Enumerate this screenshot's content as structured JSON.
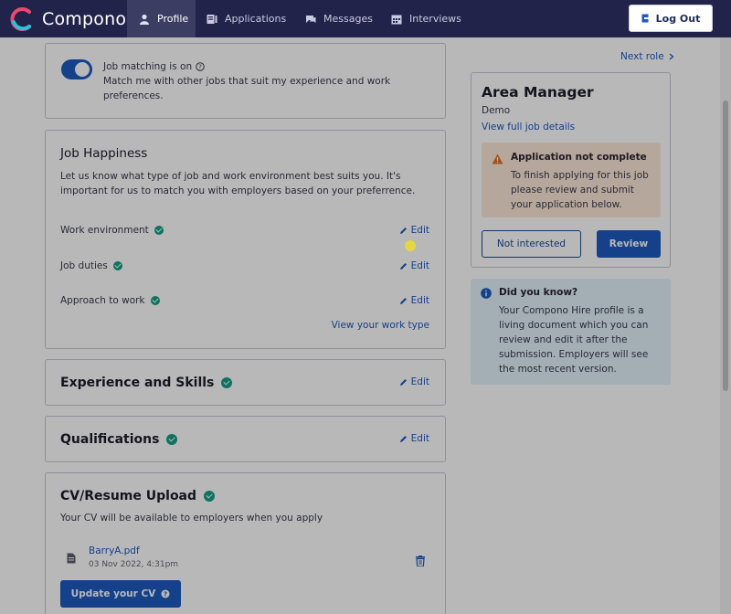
{
  "nav": {
    "brand": "Compono",
    "items": [
      {
        "label": "Profile",
        "icon": "person-icon",
        "active": true
      },
      {
        "label": "Applications",
        "icon": "applications-icon",
        "active": false
      },
      {
        "label": "Messages",
        "icon": "messages-icon",
        "active": false
      },
      {
        "label": "Interviews",
        "icon": "calendar-icon",
        "active": false
      }
    ],
    "logout_label": "Log Out"
  },
  "job_matching": {
    "title": "Job matching is on",
    "description": "Match me with other jobs that suit my experience and work preferences.",
    "enabled": true
  },
  "job_happiness": {
    "title": "Job Happiness",
    "description": "Let us know what type of job and work environment best suits you. It's important for us to match you with employers based on your preferrence.",
    "rows": [
      {
        "label": "Work environment",
        "edit": "Edit"
      },
      {
        "label": "Job duties",
        "edit": "Edit"
      },
      {
        "label": "Approach to work",
        "edit": "Edit"
      }
    ],
    "work_type_link": "View your work type"
  },
  "experience": {
    "title": "Experience and Skills",
    "edit": "Edit"
  },
  "qualifications": {
    "title": "Qualifications",
    "edit": "Edit"
  },
  "cv": {
    "title": "CV/Resume Upload",
    "description": "Your CV will be available to employers when you apply",
    "file_name": "BarryA.pdf",
    "file_date": "03 Nov 2022, 4:31pm",
    "update_label": "Update your CV"
  },
  "job_panel": {
    "next_role": "Next role",
    "title": "Area Manager",
    "company": "Demo",
    "details_link": "View full job details",
    "warning_title": "Application not complete",
    "warning_text": "To finish applying for this job please review and submit your application below.",
    "not_interested_label": "Not interested",
    "review_label": "Review"
  },
  "did_you_know": {
    "title": "Did you know?",
    "text": "Your Compono Hire profile is a living document which you can review and edit it after the submission. Employers will see the most recent version."
  },
  "colors": {
    "nav_bg": "#22234a",
    "accent": "#1d5bc0",
    "success": "#16a085",
    "warning_bg": "#fde8d8",
    "info_bg": "#e2f1fb"
  }
}
